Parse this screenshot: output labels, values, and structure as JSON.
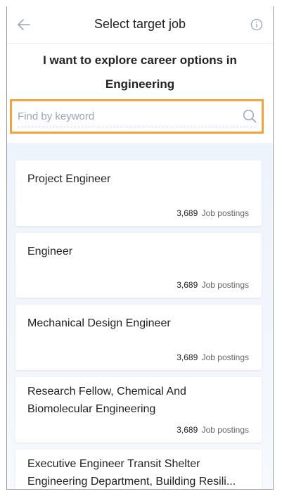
{
  "header": {
    "title": "Select target job"
  },
  "headline": {
    "line1": "I want to explore career options in",
    "line2": "Engineering"
  },
  "search": {
    "placeholder": "Find by keyword",
    "value": ""
  },
  "jobs": [
    {
      "name": "Project Engineer",
      "count": "3,689",
      "label": "Job postings"
    },
    {
      "name": "Engineer",
      "count": "3,689",
      "label": "Job postings"
    },
    {
      "name": "Mechanical Design Engineer",
      "count": "3,689",
      "label": "Job postings"
    },
    {
      "name": "Research Fellow, Chemical And Biomolecular Engineering",
      "count": "3,689",
      "label": "Job postings"
    },
    {
      "name_line1": "Executive Engineer Transit Shelter",
      "name_line2": "Engineering Department, Building Resili..."
    }
  ],
  "colors": {
    "search_border": "#f3a23c",
    "list_background": "#eef4fc"
  },
  "icons": {
    "back": "arrow-left-icon",
    "info": "info-circle-icon",
    "search": "magnifier-icon"
  }
}
